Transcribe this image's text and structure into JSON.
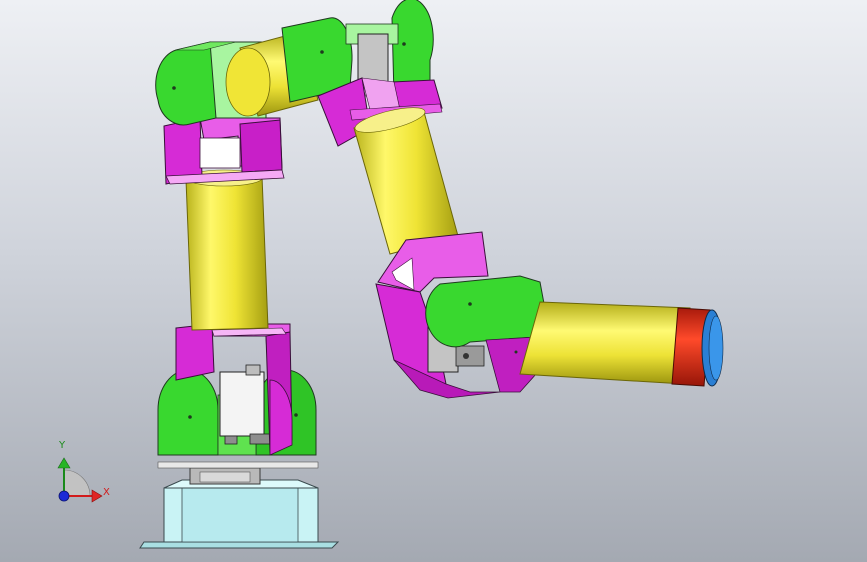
{
  "viewport": {
    "colors": {
      "base_light": "#c9f3f5",
      "joint_green": "#39d82f",
      "bracket_magenta": "#d62bd6",
      "link_yellow": "#f2ea3a",
      "servo_gray": "#c4c4c4",
      "flange_red": "#e0301a",
      "flange_blue": "#2a7fd4"
    }
  },
  "triad": {
    "y_label": "Y",
    "x_label": "X",
    "y_color": "#1a8a1a",
    "x_color": "#d21b1b",
    "origin_color": "#1b2ad6"
  }
}
